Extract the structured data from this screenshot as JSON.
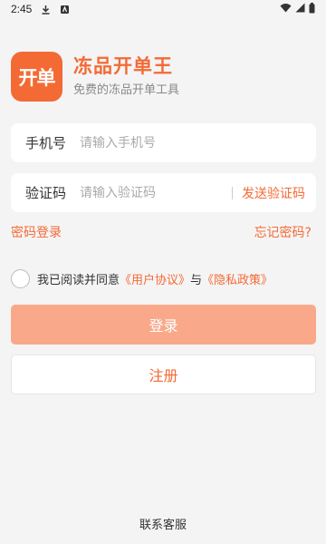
{
  "status_bar": {
    "time": "2:45",
    "icons": [
      "download-icon",
      "app-notification-icon",
      "wifi-icon",
      "signal-icon",
      "battery-icon"
    ]
  },
  "brand": {
    "logo_text": "开单",
    "title": "冻品开单王",
    "subtitle": "免费的冻品开单工具",
    "accent_color": "#f46a34"
  },
  "phone_field": {
    "label": "手机号",
    "value": "",
    "placeholder": "请输入手机号"
  },
  "code_field": {
    "label": "验证码",
    "value": "",
    "placeholder": "请输入验证码",
    "send_button": "发送验证码"
  },
  "links": {
    "password_login": "密码登录",
    "forgot_password": "忘记密码?"
  },
  "agreement": {
    "checked": false,
    "prefix": "我已阅读并同意",
    "user_agreement": "《用户协议》",
    "conjunction": "与",
    "privacy_policy": "《隐私政策》"
  },
  "buttons": {
    "login": "登录",
    "register": "注册"
  },
  "footer": {
    "contact_service": "联系客服"
  }
}
